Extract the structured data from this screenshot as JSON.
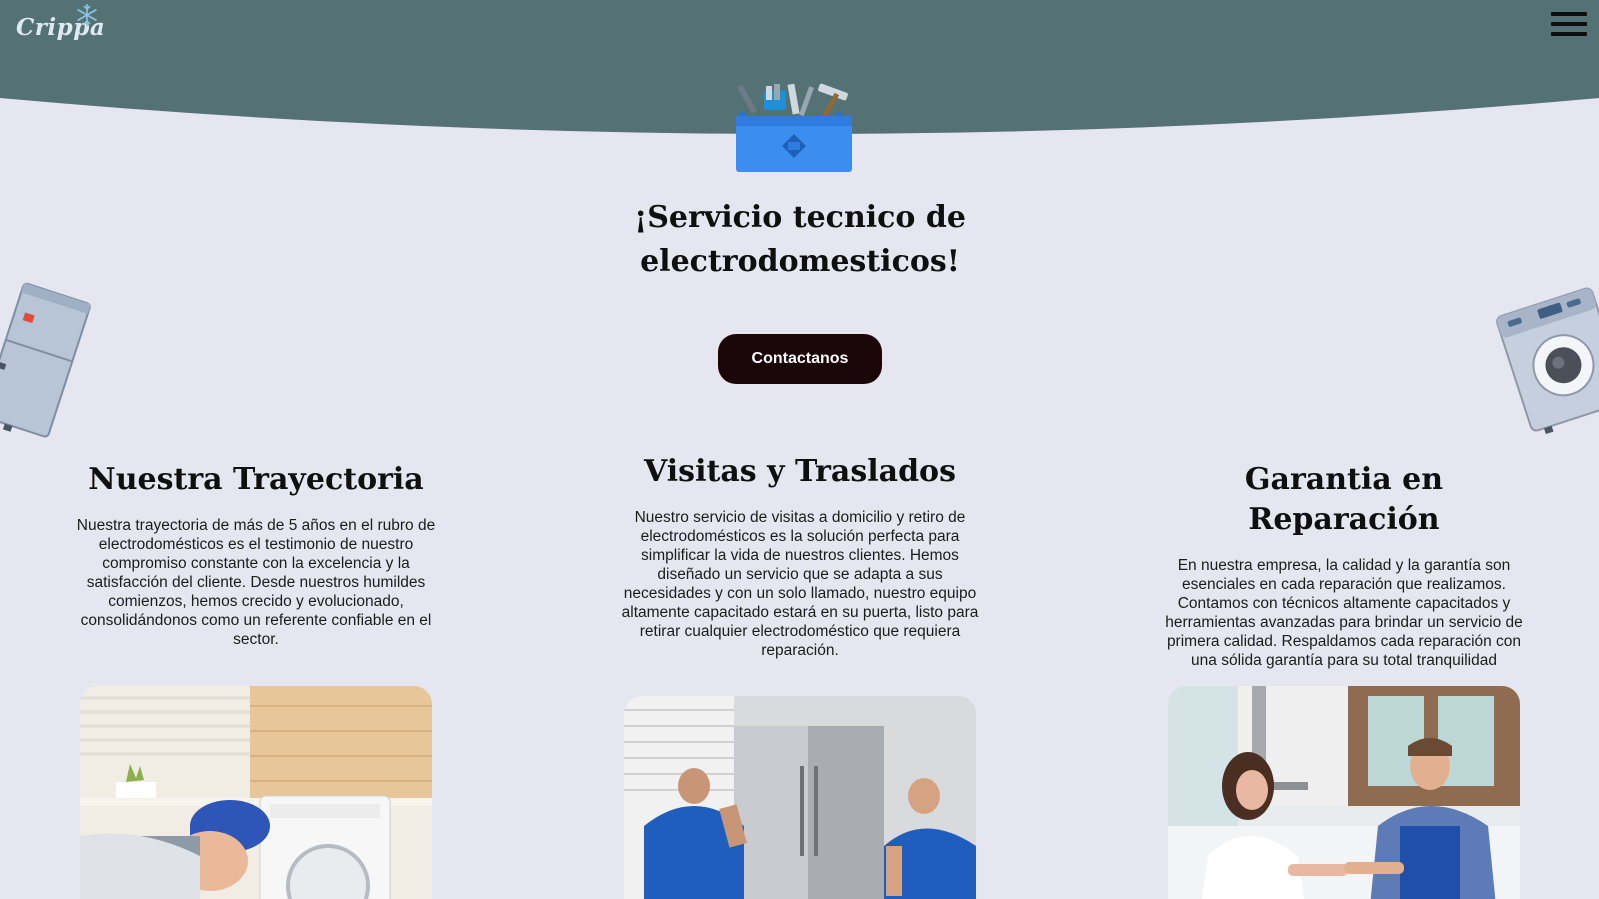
{
  "header": {
    "brand": "Crippa",
    "menu_icon": "hamburger-menu-icon",
    "color": "#547274"
  },
  "hero": {
    "icon": "toolbox-icon",
    "title": "¡Servicio tecnico de electrodomesticos!",
    "cta_label": "Contactanos",
    "cta_color": "#1a0508"
  },
  "decorations": {
    "left": "refrigerator-illustration",
    "right": "washing-machine-illustration"
  },
  "features": [
    {
      "title": "Nuestra Trayectoria",
      "text": "Nuestra trayectoria de más de 5 años en el rubro de electrodomésticos es el testimonio de nuestro compromiso constante con la excelencia y la satisfacción del cliente. Desde nuestros humildes comienzos, hemos crecido y evolucionado, consolidándonos como un referente confiable en el sector.",
      "image": "technician-repairing-washing-machine-photo"
    },
    {
      "title": "Visitas y Traslados",
      "text": "Nuestro servicio de visitas a domicilio y retiro de electrodomésticos es la solución perfecta para simplificar la vida de nuestros clientes. Hemos diseñado un servicio que se adapta a sus necesidades y con un solo llamado, nuestro equipo altamente capacitado estará en su puerta, listo para retirar cualquier electrodoméstico que requiera reparación.",
      "image": "technicians-moving-refrigerator-photo"
    },
    {
      "title": "Garantia en Reparación",
      "text": "En nuestra empresa, la calidad y la garantía son esenciales en cada reparación que realizamos. Contamos con técnicos altamente capacitados y herramientas avanzadas para brindar un servicio de primera calidad. Respaldamos cada reparación con una sólida garantía para su total tranquilidad",
      "image": "technician-handshake-customer-photo"
    }
  ],
  "colors": {
    "background": "#e6e6f1",
    "header": "#547274",
    "text": "#0f0f0f"
  }
}
